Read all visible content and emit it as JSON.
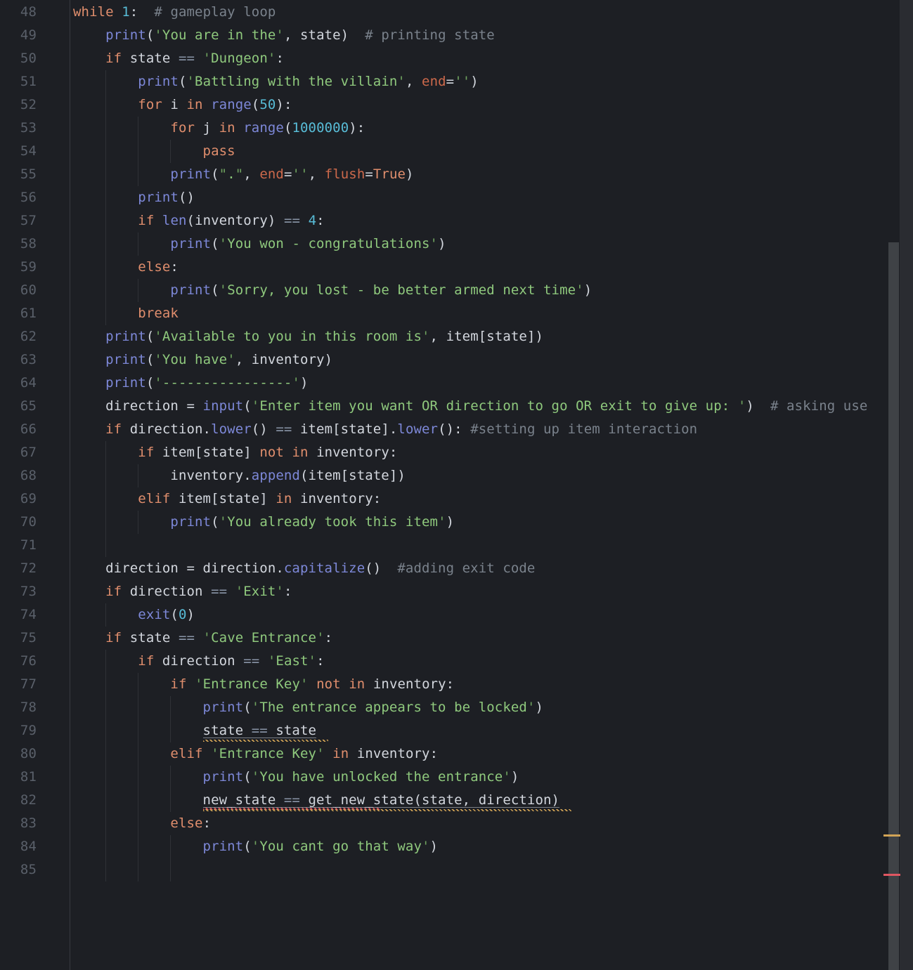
{
  "palette": {
    "bg": "#1d1f24",
    "kw": "#e08e6d",
    "fn": "#7d88d8",
    "str": "#8fc97d",
    "q": "#6fa35f",
    "num": "#58bcd7",
    "com": "#7a828c",
    "op": "#8a96a8",
    "param": "#cd694b",
    "pl": "#d3d7de",
    "lnum": "#5a606a",
    "guide": "#2f3237",
    "gutterline": "#373a40",
    "strip": "#2a2c31",
    "thumb": "#3f4246",
    "warn": "#d2a456",
    "error": "#df5762",
    "underline": "rgba(198,207,218,0.55)"
  },
  "editor": {
    "language": "python",
    "first_line_number": 48,
    "last_line_number": 85,
    "lines": [
      {
        "num": 48,
        "guides": [],
        "tokens": [
          [
            "kw",
            "while"
          ],
          [
            "pl",
            " "
          ],
          [
            "num",
            "1"
          ],
          [
            "pl",
            ":  "
          ],
          [
            "com",
            "# gameplay loop"
          ]
        ]
      },
      {
        "num": 49,
        "guides": [],
        "tokens": [
          [
            "pl",
            "    "
          ],
          [
            "fn",
            "print"
          ],
          [
            "pl",
            "("
          ],
          [
            "str",
            "'You are in the'"
          ],
          [
            "pl",
            ", state)  "
          ],
          [
            "com",
            "# printing state"
          ]
        ]
      },
      {
        "num": 50,
        "guides": [],
        "tokens": [
          [
            "pl",
            "    "
          ],
          [
            "kw",
            "if"
          ],
          [
            "pl",
            " state "
          ],
          [
            "op",
            "=="
          ],
          [
            "pl",
            " "
          ],
          [
            "str",
            "'Dungeon'"
          ],
          [
            "pl",
            ":"
          ]
        ]
      },
      {
        "num": 51,
        "guides": [
          1
        ],
        "tokens": [
          [
            "pl",
            "        "
          ],
          [
            "fn",
            "print"
          ],
          [
            "pl",
            "("
          ],
          [
            "str",
            "'Battling with the villain'"
          ],
          [
            "pl",
            ", "
          ],
          [
            "param",
            "end"
          ],
          [
            "pl",
            "="
          ],
          [
            "str",
            "''"
          ],
          [
            "pl",
            ")"
          ]
        ]
      },
      {
        "num": 52,
        "guides": [
          1
        ],
        "tokens": [
          [
            "pl",
            "        "
          ],
          [
            "kw",
            "for"
          ],
          [
            "pl",
            " i "
          ],
          [
            "kw",
            "in"
          ],
          [
            "pl",
            " "
          ],
          [
            "fn",
            "range"
          ],
          [
            "pl",
            "("
          ],
          [
            "num",
            "50"
          ],
          [
            "pl",
            "):"
          ]
        ]
      },
      {
        "num": 53,
        "guides": [
          1,
          2
        ],
        "tokens": [
          [
            "pl",
            "            "
          ],
          [
            "kw",
            "for"
          ],
          [
            "pl",
            " j "
          ],
          [
            "kw",
            "in"
          ],
          [
            "pl",
            " "
          ],
          [
            "fn",
            "range"
          ],
          [
            "pl",
            "("
          ],
          [
            "num",
            "1000000"
          ],
          [
            "pl",
            "):"
          ]
        ]
      },
      {
        "num": 54,
        "guides": [
          1,
          2,
          3
        ],
        "tokens": [
          [
            "pl",
            "                "
          ],
          [
            "kw",
            "pass"
          ]
        ]
      },
      {
        "num": 55,
        "guides": [
          1,
          2
        ],
        "tokens": [
          [
            "pl",
            "            "
          ],
          [
            "fn",
            "print"
          ],
          [
            "pl",
            "("
          ],
          [
            "str",
            "\".\""
          ],
          [
            "pl",
            ", "
          ],
          [
            "param",
            "end"
          ],
          [
            "pl",
            "="
          ],
          [
            "str",
            "''"
          ],
          [
            "pl",
            ", "
          ],
          [
            "param",
            "flush"
          ],
          [
            "pl",
            "="
          ],
          [
            "kw",
            "True"
          ],
          [
            "pl",
            ")"
          ]
        ]
      },
      {
        "num": 56,
        "guides": [
          1
        ],
        "tokens": [
          [
            "pl",
            "        "
          ],
          [
            "fn",
            "print"
          ],
          [
            "pl",
            "()"
          ]
        ]
      },
      {
        "num": 57,
        "guides": [
          1
        ],
        "tokens": [
          [
            "pl",
            "        "
          ],
          [
            "kw",
            "if"
          ],
          [
            "pl",
            " "
          ],
          [
            "fn",
            "len"
          ],
          [
            "pl",
            "(inventory) "
          ],
          [
            "op",
            "=="
          ],
          [
            "pl",
            " "
          ],
          [
            "num",
            "4"
          ],
          [
            "pl",
            ":"
          ]
        ]
      },
      {
        "num": 58,
        "guides": [
          1,
          2
        ],
        "tokens": [
          [
            "pl",
            "            "
          ],
          [
            "fn",
            "print"
          ],
          [
            "pl",
            "("
          ],
          [
            "str",
            "'You won - congratulations'"
          ],
          [
            "pl",
            ")"
          ]
        ]
      },
      {
        "num": 59,
        "guides": [
          1
        ],
        "tokens": [
          [
            "pl",
            "        "
          ],
          [
            "kw",
            "else"
          ],
          [
            "pl",
            ":"
          ]
        ]
      },
      {
        "num": 60,
        "guides": [
          1,
          2
        ],
        "tokens": [
          [
            "pl",
            "            "
          ],
          [
            "fn",
            "print"
          ],
          [
            "pl",
            "("
          ],
          [
            "str",
            "'Sorry, you lost - be better armed next time'"
          ],
          [
            "pl",
            ")"
          ]
        ]
      },
      {
        "num": 61,
        "guides": [
          1
        ],
        "tokens": [
          [
            "pl",
            "        "
          ],
          [
            "kw",
            "break"
          ]
        ]
      },
      {
        "num": 62,
        "guides": [],
        "tokens": [
          [
            "pl",
            "    "
          ],
          [
            "fn",
            "print"
          ],
          [
            "pl",
            "("
          ],
          [
            "str",
            "'Available to you in this room is'"
          ],
          [
            "pl",
            ", item[state])"
          ]
        ]
      },
      {
        "num": 63,
        "guides": [],
        "tokens": [
          [
            "pl",
            "    "
          ],
          [
            "fn",
            "print"
          ],
          [
            "pl",
            "("
          ],
          [
            "str",
            "'You have'"
          ],
          [
            "pl",
            ", inventory)"
          ]
        ]
      },
      {
        "num": 64,
        "guides": [],
        "tokens": [
          [
            "pl",
            "    "
          ],
          [
            "fn",
            "print"
          ],
          [
            "pl",
            "("
          ],
          [
            "str",
            "'----------------'"
          ],
          [
            "pl",
            ")"
          ]
        ]
      },
      {
        "num": 65,
        "guides": [],
        "tokens": [
          [
            "pl",
            "    direction = "
          ],
          [
            "fn",
            "input"
          ],
          [
            "pl",
            "("
          ],
          [
            "str",
            "'Enter item you want OR direction to go OR exit to give up: '"
          ],
          [
            "pl",
            ")  "
          ],
          [
            "com",
            "# asking use"
          ]
        ]
      },
      {
        "num": 66,
        "guides": [],
        "tokens": [
          [
            "pl",
            "    "
          ],
          [
            "kw",
            "if"
          ],
          [
            "pl",
            " direction."
          ],
          [
            "fn",
            "lower"
          ],
          [
            "pl",
            "() "
          ],
          [
            "op",
            "=="
          ],
          [
            "pl",
            " item[state]."
          ],
          [
            "fn",
            "lower"
          ],
          [
            "pl",
            "(): "
          ],
          [
            "com",
            "#setting up item interaction"
          ]
        ]
      },
      {
        "num": 67,
        "guides": [
          1
        ],
        "tokens": [
          [
            "pl",
            "        "
          ],
          [
            "kw",
            "if"
          ],
          [
            "pl",
            " item[state] "
          ],
          [
            "kw",
            "not"
          ],
          [
            "pl",
            " "
          ],
          [
            "kw",
            "in"
          ],
          [
            "pl",
            " inventory:"
          ]
        ]
      },
      {
        "num": 68,
        "guides": [
          1,
          2
        ],
        "tokens": [
          [
            "pl",
            "            inventory."
          ],
          [
            "fn",
            "append"
          ],
          [
            "pl",
            "(item[state])"
          ]
        ]
      },
      {
        "num": 69,
        "guides": [
          1
        ],
        "tokens": [
          [
            "pl",
            "        "
          ],
          [
            "kw",
            "elif"
          ],
          [
            "pl",
            " item[state] "
          ],
          [
            "kw",
            "in"
          ],
          [
            "pl",
            " inventory:"
          ]
        ]
      },
      {
        "num": 70,
        "guides": [
          1,
          2
        ],
        "tokens": [
          [
            "pl",
            "            "
          ],
          [
            "fn",
            "print"
          ],
          [
            "pl",
            "("
          ],
          [
            "str",
            "'You already took this item'"
          ],
          [
            "pl",
            ")"
          ]
        ]
      },
      {
        "num": 71,
        "guides": [
          1
        ],
        "tokens": []
      },
      {
        "num": 72,
        "guides": [],
        "tokens": [
          [
            "pl",
            "    direction = direction."
          ],
          [
            "fn",
            "capitalize"
          ],
          [
            "pl",
            "()  "
          ],
          [
            "com",
            "#adding exit code"
          ]
        ]
      },
      {
        "num": 73,
        "guides": [],
        "tokens": [
          [
            "pl",
            "    "
          ],
          [
            "kw",
            "if"
          ],
          [
            "pl",
            " direction "
          ],
          [
            "op",
            "=="
          ],
          [
            "pl",
            " "
          ],
          [
            "str",
            "'Exit'"
          ],
          [
            "pl",
            ":"
          ]
        ]
      },
      {
        "num": 74,
        "guides": [
          1
        ],
        "tokens": [
          [
            "pl",
            "        "
          ],
          [
            "fn",
            "exit"
          ],
          [
            "pl",
            "("
          ],
          [
            "num",
            "0"
          ],
          [
            "pl",
            ")"
          ]
        ]
      },
      {
        "num": 75,
        "guides": [],
        "tokens": [
          [
            "pl",
            "    "
          ],
          [
            "kw",
            "if"
          ],
          [
            "pl",
            " state "
          ],
          [
            "op",
            "=="
          ],
          [
            "pl",
            " "
          ],
          [
            "str",
            "'Cave Entrance'"
          ],
          [
            "pl",
            ":"
          ]
        ]
      },
      {
        "num": 76,
        "guides": [
          1
        ],
        "tokens": [
          [
            "pl",
            "        "
          ],
          [
            "kw",
            "if"
          ],
          [
            "pl",
            " direction "
          ],
          [
            "op",
            "=="
          ],
          [
            "pl",
            " "
          ],
          [
            "str",
            "'East'"
          ],
          [
            "pl",
            ":"
          ]
        ]
      },
      {
        "num": 77,
        "guides": [
          1,
          2
        ],
        "tokens": [
          [
            "pl",
            "            "
          ],
          [
            "kw",
            "if"
          ],
          [
            "pl",
            " "
          ],
          [
            "str",
            "'Entrance Key'"
          ],
          [
            "pl",
            " "
          ],
          [
            "kw",
            "not"
          ],
          [
            "pl",
            " "
          ],
          [
            "kw",
            "in"
          ],
          [
            "pl",
            " inventory:"
          ]
        ]
      },
      {
        "num": 78,
        "guides": [
          1,
          2,
          3
        ],
        "tokens": [
          [
            "pl",
            "                "
          ],
          [
            "fn",
            "print"
          ],
          [
            "pl",
            "("
          ],
          [
            "str",
            "'The entrance appears to be locked'"
          ],
          [
            "pl",
            ")"
          ]
        ]
      },
      {
        "num": 79,
        "guides": [
          1,
          2,
          3
        ],
        "tokens": [
          [
            "pl",
            "                state "
          ],
          [
            "op",
            "=="
          ],
          [
            "pl",
            " state"
          ]
        ],
        "underline": [
          16,
          30
        ],
        "squiggles": [
          [
            "warn",
            16,
            31.5
          ]
        ]
      },
      {
        "num": 80,
        "guides": [
          1,
          2
        ],
        "tokens": [
          [
            "pl",
            "            "
          ],
          [
            "kw",
            "elif"
          ],
          [
            "pl",
            " "
          ],
          [
            "str",
            "'Entrance Key'"
          ],
          [
            "pl",
            " "
          ],
          [
            "kw",
            "in"
          ],
          [
            "pl",
            " inventory:"
          ]
        ]
      },
      {
        "num": 81,
        "guides": [
          1,
          2,
          3
        ],
        "tokens": [
          [
            "pl",
            "                "
          ],
          [
            "fn",
            "print"
          ],
          [
            "pl",
            "("
          ],
          [
            "str",
            "'You have unlocked the entrance'"
          ],
          [
            "pl",
            ")"
          ]
        ]
      },
      {
        "num": 82,
        "guides": [
          1,
          2,
          3
        ],
        "tokens": [
          [
            "pl",
            "                new_state "
          ],
          [
            "op",
            "=="
          ],
          [
            "pl",
            " get_new_state(state, direction)"
          ]
        ],
        "underline": [
          16,
          60
        ],
        "squiggles": [
          [
            "error",
            16,
            38
          ],
          [
            "warn",
            16,
            61.5
          ]
        ]
      },
      {
        "num": 83,
        "guides": [
          1,
          2
        ],
        "tokens": [
          [
            "pl",
            "            "
          ],
          [
            "kw",
            "else"
          ],
          [
            "pl",
            ":"
          ]
        ]
      },
      {
        "num": 84,
        "guides": [
          1,
          2,
          3
        ],
        "tokens": [
          [
            "pl",
            "                "
          ],
          [
            "fn",
            "print"
          ],
          [
            "pl",
            "("
          ],
          [
            "str",
            "'You cant go that way'"
          ],
          [
            "pl",
            ")"
          ]
        ]
      },
      {
        "num": 85,
        "guides": [
          1,
          2,
          3
        ],
        "tokens": []
      }
    ]
  },
  "scrollbar": {
    "thumb_present": true,
    "overview_marks": [
      {
        "kind": "warning"
      },
      {
        "kind": "error"
      }
    ]
  }
}
